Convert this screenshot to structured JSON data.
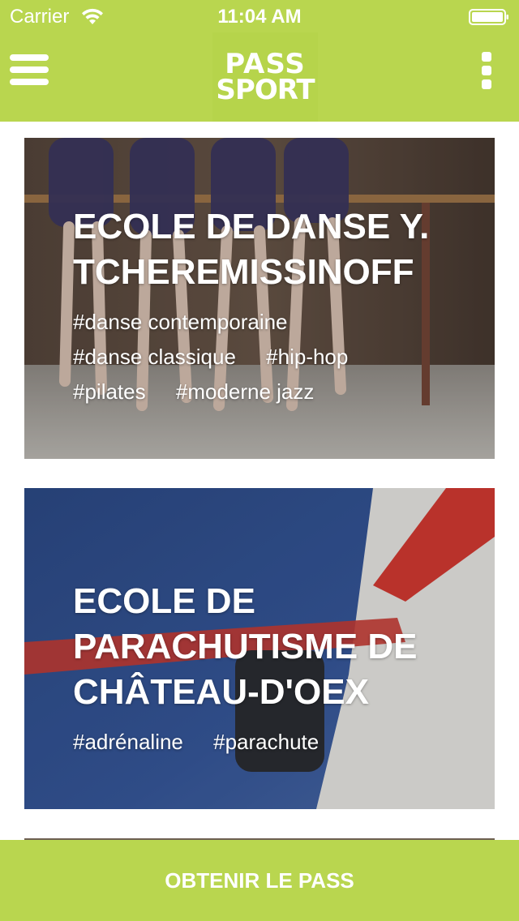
{
  "status_bar": {
    "carrier": "Carrier",
    "time": "11:04 AM"
  },
  "nav": {
    "logo_line1": "PASS",
    "logo_line2": "SPORT",
    "accent_color": "#b9d64f"
  },
  "cards": [
    {
      "title": "ECOLE DE DANSE Y. TCHEREMISSINOFF",
      "tags": [
        "#danse contemporaine",
        "#danse classique",
        "#hip-hop",
        "#pilates",
        "#moderne jazz"
      ]
    },
    {
      "title": "ECOLE DE PARACHUTISME DE CHÂTEAU-D'OEX",
      "tags": [
        "#adrénaline",
        "#parachute"
      ]
    }
  ],
  "cta": {
    "label": "OBTENIR LE PASS"
  }
}
